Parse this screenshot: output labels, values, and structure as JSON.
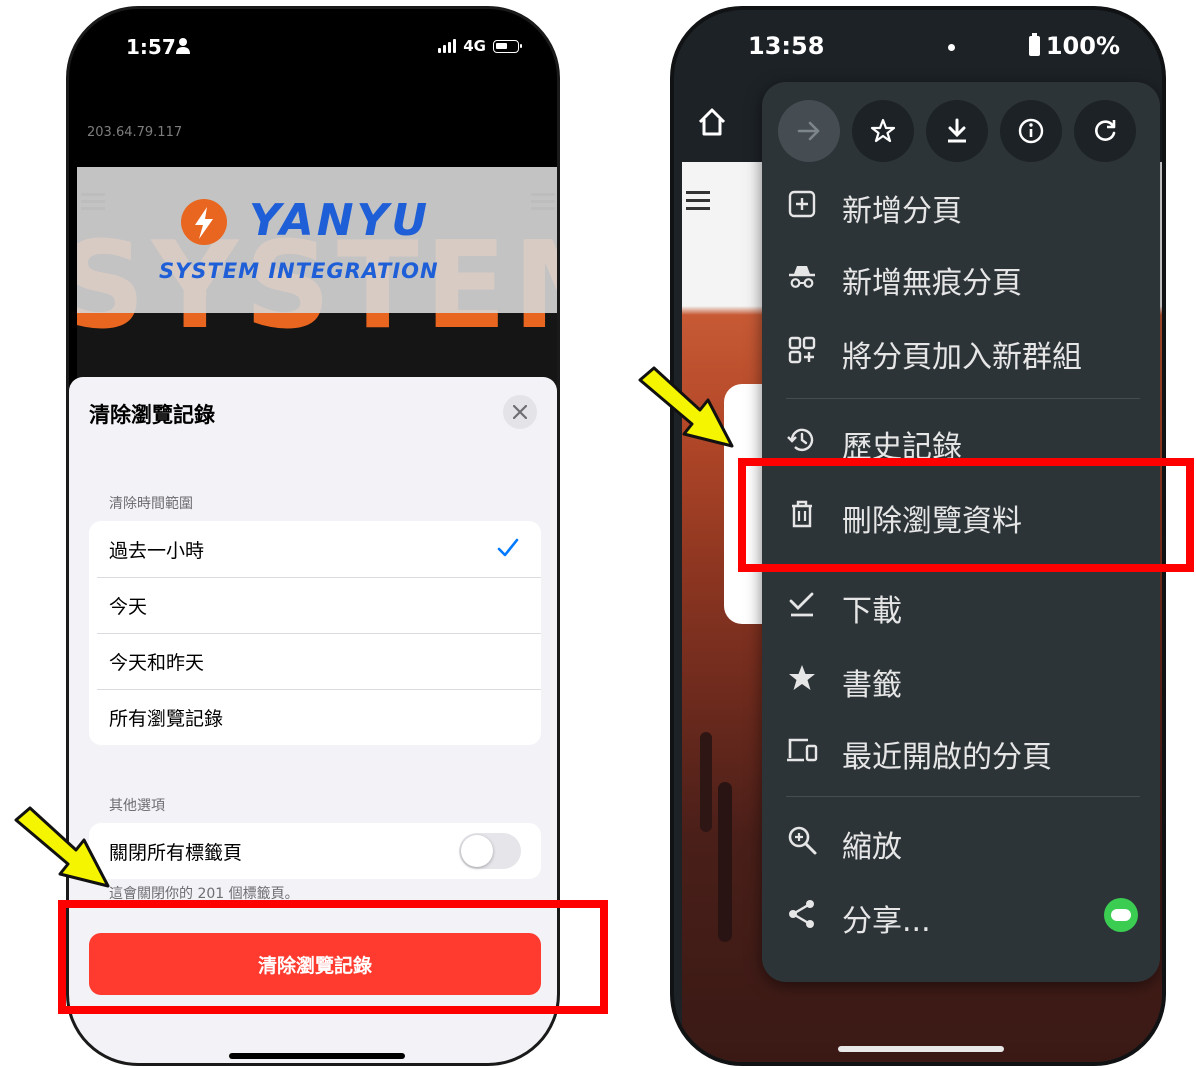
{
  "left_phone": {
    "status": {
      "time": "1:57",
      "network": "4G"
    },
    "url_text": "203.64.79.117",
    "logo": {
      "brand": "YANYU",
      "subtitle": "SYSTEM INTEGRATION",
      "background_word": "SYSTEM"
    },
    "sheet": {
      "title": "清除瀏覽記錄",
      "time_range_label": "清除時間範圍",
      "time_range_options": [
        {
          "label": "過去一小時",
          "selected": true
        },
        {
          "label": "今天",
          "selected": false
        },
        {
          "label": "今天和昨天",
          "selected": false
        },
        {
          "label": "所有瀏覽記錄",
          "selected": false
        }
      ],
      "other_options_label": "其他選項",
      "close_tabs_label": "關閉所有標籤頁",
      "close_tabs_enabled": false,
      "close_tabs_note": "這會關閉你的 201 個標籤頁。",
      "clear_button": "清除瀏覽記錄"
    }
  },
  "right_phone": {
    "status": {
      "time": "13:58",
      "battery": "100%"
    },
    "menu_items": [
      {
        "label": "新增分頁",
        "icon": "new-tab-icon"
      },
      {
        "label": "新增無痕分頁",
        "icon": "incognito-icon"
      },
      {
        "label": "將分頁加入新群組",
        "icon": "tab-group-icon"
      },
      {
        "label": "歷史記錄",
        "icon": "history-icon"
      },
      {
        "label": "刪除瀏覽資料",
        "icon": "trash-icon"
      },
      {
        "label": "下載",
        "icon": "download-done-icon"
      },
      {
        "label": "書籤",
        "icon": "star-icon"
      },
      {
        "label": "最近開啟的分頁",
        "icon": "devices-icon"
      },
      {
        "label": "縮放",
        "icon": "zoom-icon"
      },
      {
        "label": "分享...",
        "icon": "share-icon"
      }
    ]
  },
  "colors": {
    "highlight": "#ff0000",
    "arrow": "#f5f500",
    "ios_destructive": "#ff3b30",
    "ios_check": "#007aff"
  }
}
